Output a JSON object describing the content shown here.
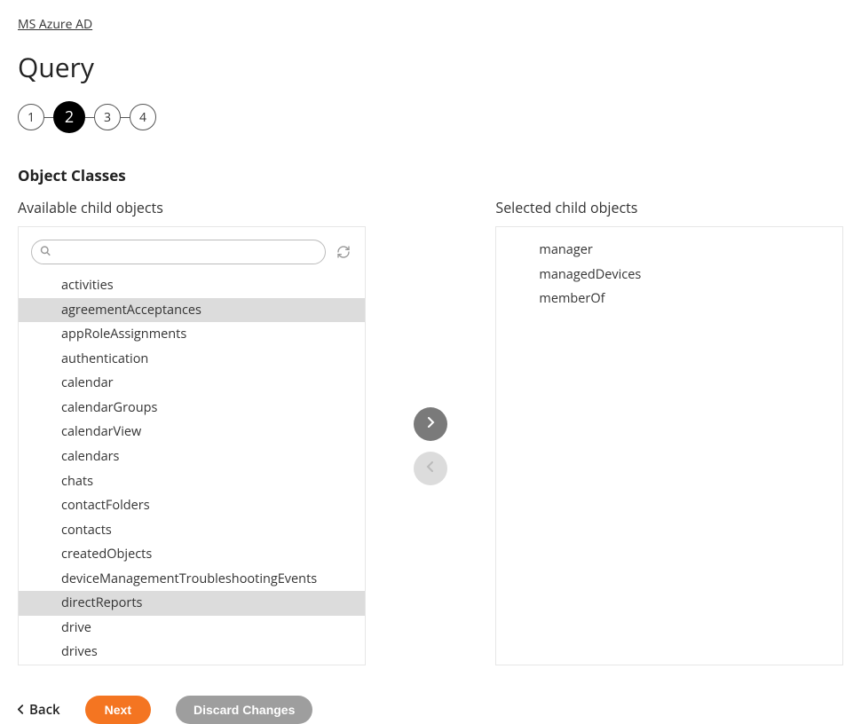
{
  "breadcrumb": {
    "label": "MS Azure AD"
  },
  "page": {
    "title": "Query"
  },
  "stepper": {
    "steps": [
      "1",
      "2",
      "3",
      "4"
    ],
    "active_index": 1
  },
  "object_classes": {
    "heading": "Object Classes",
    "available": {
      "title": "Available child objects",
      "search": {
        "placeholder": "",
        "value": ""
      },
      "items": [
        {
          "label": "activities",
          "highlight": false
        },
        {
          "label": "agreementAcceptances",
          "highlight": true
        },
        {
          "label": "appRoleAssignments",
          "highlight": false
        },
        {
          "label": "authentication",
          "highlight": false
        },
        {
          "label": "calendar",
          "highlight": false
        },
        {
          "label": "calendarGroups",
          "highlight": false
        },
        {
          "label": "calendarView",
          "highlight": false
        },
        {
          "label": "calendars",
          "highlight": false
        },
        {
          "label": "chats",
          "highlight": false
        },
        {
          "label": "contactFolders",
          "highlight": false
        },
        {
          "label": "contacts",
          "highlight": false
        },
        {
          "label": "createdObjects",
          "highlight": false
        },
        {
          "label": "deviceManagementTroubleshootingEvents",
          "highlight": false
        },
        {
          "label": "directReports",
          "highlight": true
        },
        {
          "label": "drive",
          "highlight": false
        },
        {
          "label": "drives",
          "highlight": false
        }
      ]
    },
    "selected": {
      "title": "Selected child objects",
      "items": [
        {
          "label": "manager"
        },
        {
          "label": "managedDevices"
        },
        {
          "label": "memberOf"
        }
      ]
    }
  },
  "footer": {
    "back": "Back",
    "next": "Next",
    "discard": "Discard Changes"
  }
}
